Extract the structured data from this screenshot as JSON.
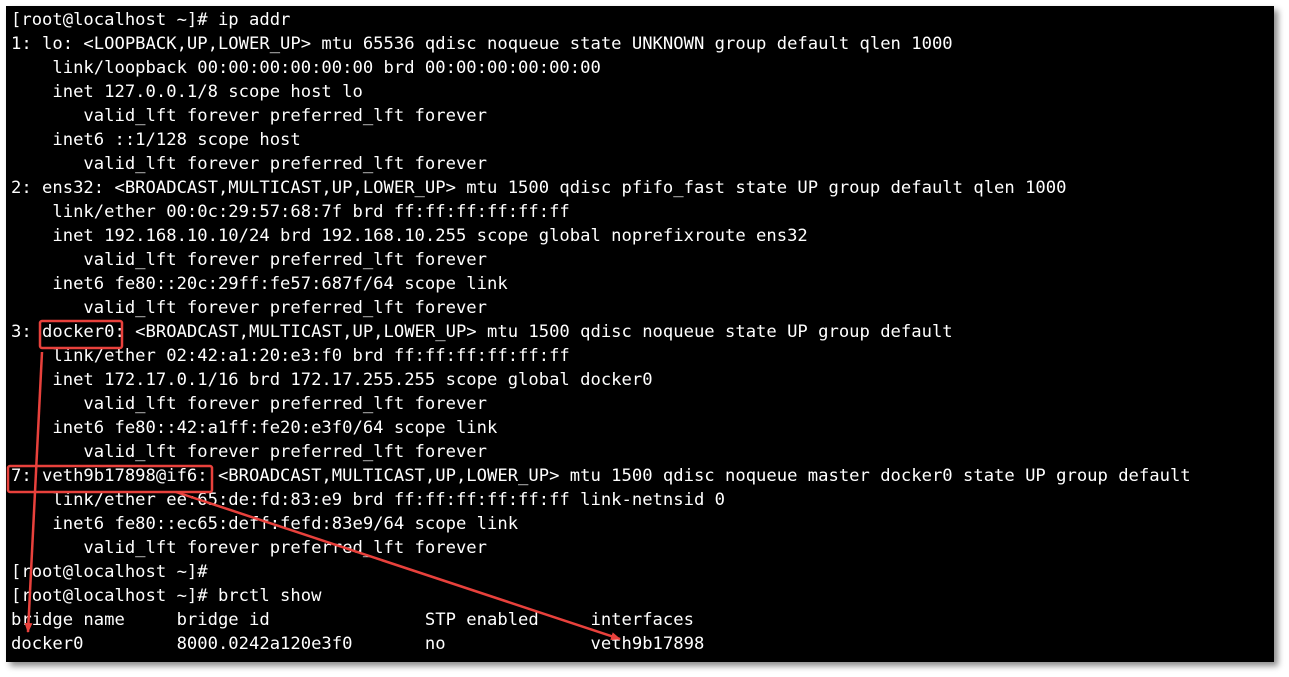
{
  "accent_color": "#e8413c",
  "terminal": {
    "background": "#000000",
    "foreground": "#ffffff",
    "lines": [
      "[root@localhost ~]# ip addr",
      "1: lo: <LOOPBACK,UP,LOWER_UP> mtu 65536 qdisc noqueue state UNKNOWN group default qlen 1000",
      "    link/loopback 00:00:00:00:00:00 brd 00:00:00:00:00:00",
      "    inet 127.0.0.1/8 scope host lo",
      "       valid_lft forever preferred_lft forever",
      "    inet6 ::1/128 scope host",
      "       valid_lft forever preferred_lft forever",
      "2: ens32: <BROADCAST,MULTICAST,UP,LOWER_UP> mtu 1500 qdisc pfifo_fast state UP group default qlen 1000",
      "    link/ether 00:0c:29:57:68:7f brd ff:ff:ff:ff:ff:ff",
      "    inet 192.168.10.10/24 brd 192.168.10.255 scope global noprefixroute ens32",
      "       valid_lft forever preferred_lft forever",
      "    inet6 fe80::20c:29ff:fe57:687f/64 scope link",
      "       valid_lft forever preferred_lft forever",
      "3: docker0: <BROADCAST,MULTICAST,UP,LOWER_UP> mtu 1500 qdisc noqueue state UP group default",
      "    link/ether 02:42:a1:20:e3:f0 brd ff:ff:ff:ff:ff:ff",
      "    inet 172.17.0.1/16 brd 172.17.255.255 scope global docker0",
      "       valid_lft forever preferred_lft forever",
      "    inet6 fe80::42:a1ff:fe20:e3f0/64 scope link",
      "       valid_lft forever preferred_lft forever",
      "7: veth9b17898@if6: <BROADCAST,MULTICAST,UP,LOWER_UP> mtu 1500 qdisc noqueue master docker0 state UP group default",
      "    link/ether ee:65:de:fd:83:e9 brd ff:ff:ff:ff:ff:ff link-netnsid 0",
      "    inet6 fe80::ec65:deff:fefd:83e9/64 scope link",
      "       valid_lft forever preferred_lft forever",
      "[root@localhost ~]#",
      "[root@localhost ~]# brctl show",
      "bridge name     bridge id               STP enabled     interfaces",
      "docker0         8000.0242a120e3f0       no              veth9b17898"
    ]
  }
}
